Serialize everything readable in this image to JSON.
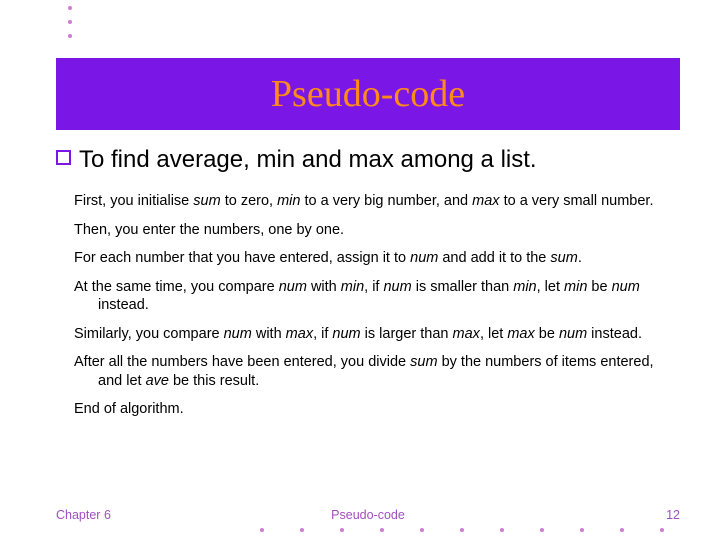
{
  "title": "Pseudo-code",
  "heading": "To find average, min and max among a list.",
  "paragraphs": {
    "p0_a": "First, you initialise ",
    "p0_b": "sum",
    "p0_c": " to zero, ",
    "p0_d": "min",
    "p0_e": " to a very big number, and ",
    "p0_f": "max",
    "p0_g": " to a very small number.",
    "p1": "Then, you enter the numbers, one by one.",
    "p2_a": "For each number that you have entered, assign it to ",
    "p2_b": "num",
    "p2_c": " and add it to the ",
    "p2_d": "sum",
    "p2_e": ".",
    "p3_a": "At the same time, you compare ",
    "p3_b": "num",
    "p3_c": " with ",
    "p3_d": "min",
    "p3_e": ", if ",
    "p3_f": "num",
    "p3_g": " is smaller than ",
    "p3_h": "min",
    "p3_i": ", let ",
    "p3_j": "min",
    "p3_k": " be ",
    "p3_l": "num",
    "p3_m": " instead.",
    "p4_a": "Similarly, you compare ",
    "p4_b": "num",
    "p4_c": " with ",
    "p4_d": "max",
    "p4_e": ", if ",
    "p4_f": "num",
    "p4_g": " is larger than ",
    "p4_h": "max",
    "p4_i": ", let ",
    "p4_j": "max",
    "p4_k": " be ",
    "p4_l": "num",
    "p4_m": " instead.",
    "p5_a": "After all the numbers have been entered, you divide ",
    "p5_b": "sum",
    "p5_c": " by the numbers of items entered, and let ",
    "p5_d": "ave",
    "p5_e": " be this result.",
    "p6": "End of algorithm."
  },
  "footer": {
    "left": "Chapter 6",
    "center": "Pseudo-code",
    "right": "12"
  },
  "colors": {
    "accent": "#7a17e6",
    "title_text": "#ff8a1a",
    "footer_text": "#a24fbf",
    "dot": "#cf7dd3"
  }
}
